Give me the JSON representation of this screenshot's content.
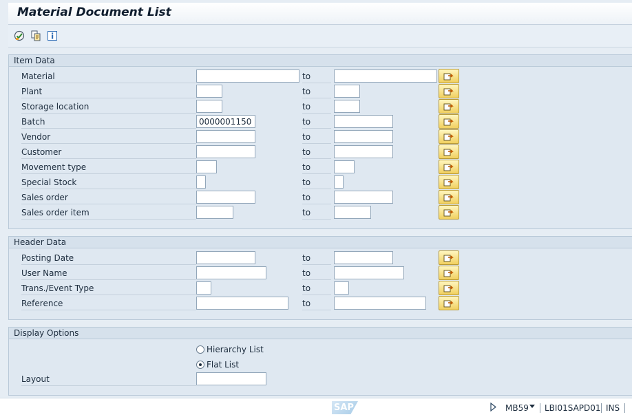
{
  "window": {
    "title": "Material Document List"
  },
  "toolbar": {
    "icons": [
      "execute-icon",
      "copy-variant-icon",
      "info-icon"
    ]
  },
  "item_data": {
    "header": "Item Data",
    "to_label": "to",
    "rows": [
      {
        "label": "Material",
        "from_value": "",
        "to_value": ""
      },
      {
        "label": "Plant",
        "from_value": "",
        "to_value": ""
      },
      {
        "label": "Storage location",
        "from_value": "",
        "to_value": ""
      },
      {
        "label": "Batch",
        "from_value": "0000001150",
        "to_value": ""
      },
      {
        "label": "Vendor",
        "from_value": "",
        "to_value": ""
      },
      {
        "label": "Customer",
        "from_value": "",
        "to_value": ""
      },
      {
        "label": "Movement type",
        "from_value": "",
        "to_value": ""
      },
      {
        "label": "Special Stock",
        "from_value": "",
        "to_value": ""
      },
      {
        "label": "Sales order",
        "from_value": "",
        "to_value": ""
      },
      {
        "label": "Sales order item",
        "from_value": "",
        "to_value": ""
      }
    ]
  },
  "header_data": {
    "header": "Header Data",
    "to_label": "to",
    "rows": [
      {
        "label": "Posting Date",
        "from_value": "",
        "to_value": ""
      },
      {
        "label": "User Name",
        "from_value": "",
        "to_value": ""
      },
      {
        "label": "Trans./Event Type",
        "from_value": "",
        "to_value": ""
      },
      {
        "label": "Reference",
        "from_value": "",
        "to_value": ""
      }
    ]
  },
  "display_options": {
    "header": "Display Options",
    "radios": [
      {
        "label": "Hierarchy List",
        "checked": false
      },
      {
        "label": "Flat List",
        "checked": true
      }
    ],
    "layout_label": "Layout",
    "layout_value": ""
  },
  "statusbar": {
    "logo_text": "SAP",
    "transaction": "MB59",
    "server": "LBI01SAPD01",
    "mode": "INS"
  },
  "colors": {
    "multi_select_button": "#f1d060",
    "group_background": "#dfe8f1"
  }
}
